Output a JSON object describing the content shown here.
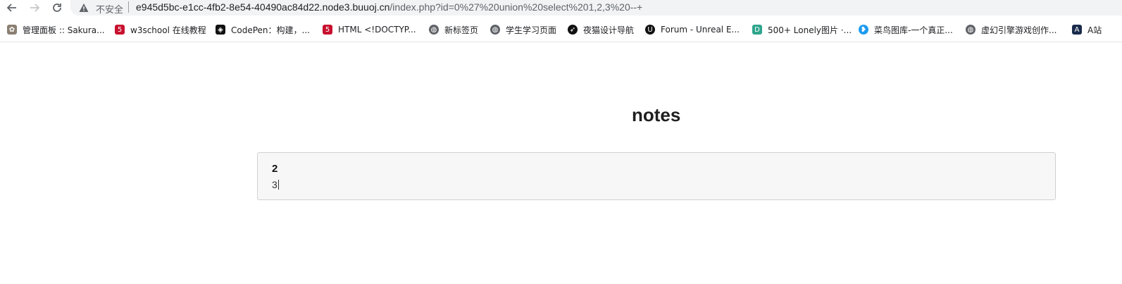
{
  "browser": {
    "insecure_label": "不安全",
    "url_host": "e945d5bc-e1cc-4fb2-8e54-40490ac84d22.node3.buuoj.cn",
    "url_path": "/index.php?id=0%27%20union%20select%201,2,3%20--+"
  },
  "bookmarks": [
    {
      "label": "管理面板 :: Sakura...",
      "icon": "sakura-icon",
      "color": "#8a7f72"
    },
    {
      "label": "w3school 在线教程",
      "icon": "w3school-icon",
      "color": "#c8102e"
    },
    {
      "label": "CodePen：构建，...",
      "icon": "codepen-icon",
      "color": "#111111"
    },
    {
      "label": "HTML <!DOCTYP...",
      "icon": "w3school-icon",
      "color": "#c8102e"
    },
    {
      "label": "新标签页",
      "icon": "globe-icon",
      "color": "#5f6368"
    },
    {
      "label": "学生学习页面",
      "icon": "globe-icon",
      "color": "#5f6368"
    },
    {
      "label": "夜猫设计导航",
      "icon": "feather-icon",
      "color": "#111111"
    },
    {
      "label": "Forum - Unreal E...",
      "icon": "unreal-icon",
      "color": "#111111"
    },
    {
      "label": "500+ Lonely图片 ·...",
      "icon": "unsplash-icon",
      "color": "#2ea58c"
    },
    {
      "label": "菜鸟图库-一个真正...",
      "icon": "bird-icon",
      "color": "#1d9bf0"
    },
    {
      "label": "虚幻引擎游戏创作...",
      "icon": "globe-icon",
      "color": "#5f6368"
    },
    {
      "label": "A站",
      "icon": "acfun-icon",
      "color": "#1a2b4c"
    }
  ],
  "page": {
    "title": "notes",
    "note": {
      "title": "2",
      "body": "3"
    }
  }
}
